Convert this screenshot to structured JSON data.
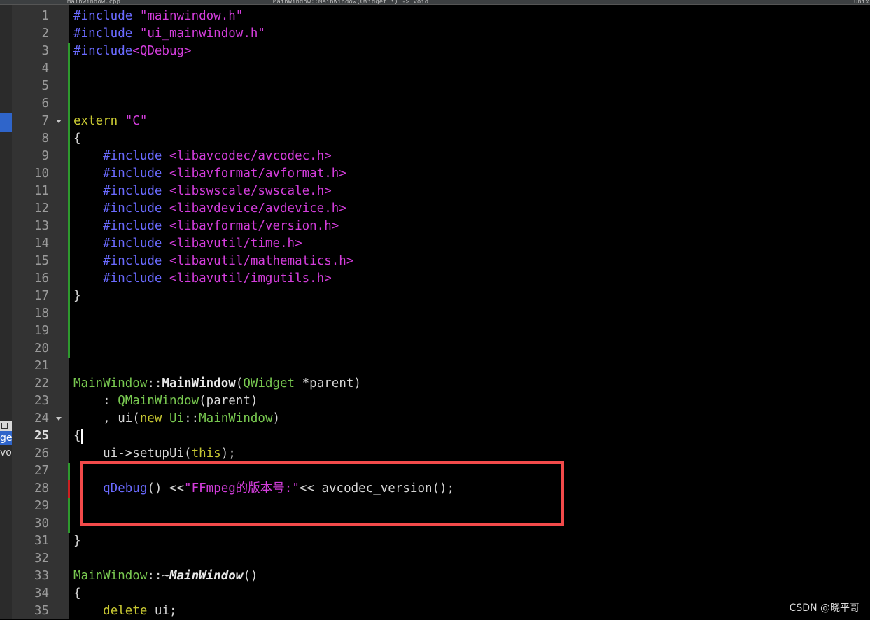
{
  "tabs": {
    "left": "mainwindow.cpp",
    "middle": "MainWindow::MainWindow(QWidget *) -> void",
    "right": "Unix"
  },
  "colors": {
    "keyword": "#c8c832",
    "preprocessor": "#6a6aff",
    "string": "#d33ddb",
    "type": "#78c850",
    "plain": "#d6d6d6",
    "highlight_box": "#f24a4a",
    "added_marker": "#2e9a2e",
    "modified_marker": "#cc2020"
  },
  "left_pane": {
    "items": [
      {
        "label": "get",
        "active": true
      },
      {
        "label": "voi",
        "active": false
      }
    ]
  },
  "editor": {
    "current_line": 25,
    "lines": [
      {
        "n": "1",
        "tokens": [
          {
            "t": "#include ",
            "c": "preprocessor"
          },
          {
            "t": "\"mainwindow.h\"",
            "c": "string"
          }
        ]
      },
      {
        "n": "2",
        "tokens": [
          {
            "t": "#include ",
            "c": "preprocessor"
          },
          {
            "t": "\"ui_mainwindow.h\"",
            "c": "string"
          }
        ]
      },
      {
        "n": "3",
        "mark": "added_marker",
        "tokens": [
          {
            "t": "#include",
            "c": "preprocessor"
          },
          {
            "t": "<QDebug>",
            "c": "string"
          }
        ]
      },
      {
        "n": "4",
        "mark": "added_marker",
        "tokens": []
      },
      {
        "n": "5",
        "mark": "added_marker",
        "tokens": []
      },
      {
        "n": "6",
        "mark": "added_marker",
        "tokens": []
      },
      {
        "n": "7",
        "mark": "added_marker",
        "fold": true,
        "tokens": [
          {
            "t": "extern ",
            "c": "keyword"
          },
          {
            "t": "\"C\"",
            "c": "string"
          }
        ]
      },
      {
        "n": "8",
        "mark": "added_marker",
        "tokens": [
          {
            "t": "{",
            "c": "plain"
          }
        ]
      },
      {
        "n": "9",
        "mark": "added_marker",
        "tokens": [
          {
            "t": "    #include ",
            "c": "preprocessor"
          },
          {
            "t": "<libavcodec/avcodec.h>",
            "c": "string"
          }
        ]
      },
      {
        "n": "10",
        "mark": "added_marker",
        "tokens": [
          {
            "t": "    #include ",
            "c": "preprocessor"
          },
          {
            "t": "<libavformat/avformat.h>",
            "c": "string"
          }
        ]
      },
      {
        "n": "11",
        "mark": "added_marker",
        "tokens": [
          {
            "t": "    #include ",
            "c": "preprocessor"
          },
          {
            "t": "<libswscale/swscale.h>",
            "c": "string"
          }
        ]
      },
      {
        "n": "12",
        "mark": "added_marker",
        "tokens": [
          {
            "t": "    #include ",
            "c": "preprocessor"
          },
          {
            "t": "<libavdevice/avdevice.h>",
            "c": "string"
          }
        ]
      },
      {
        "n": "13",
        "mark": "added_marker",
        "tokens": [
          {
            "t": "    #include ",
            "c": "preprocessor"
          },
          {
            "t": "<libavformat/version.h>",
            "c": "string"
          }
        ]
      },
      {
        "n": "14",
        "mark": "added_marker",
        "tokens": [
          {
            "t": "    #include ",
            "c": "preprocessor"
          },
          {
            "t": "<libavutil/time.h>",
            "c": "string"
          }
        ]
      },
      {
        "n": "15",
        "mark": "added_marker",
        "tokens": [
          {
            "t": "    #include ",
            "c": "preprocessor"
          },
          {
            "t": "<libavutil/mathematics.h>",
            "c": "string"
          }
        ]
      },
      {
        "n": "16",
        "mark": "added_marker",
        "tokens": [
          {
            "t": "    #include ",
            "c": "preprocessor"
          },
          {
            "t": "<libavutil/imgutils.h>",
            "c": "string"
          }
        ]
      },
      {
        "n": "17",
        "mark": "added_marker",
        "tokens": [
          {
            "t": "}",
            "c": "plain"
          }
        ]
      },
      {
        "n": "18",
        "mark": "added_marker",
        "tokens": []
      },
      {
        "n": "19",
        "mark": "added_marker",
        "tokens": []
      },
      {
        "n": "20",
        "mark": "added_marker",
        "tokens": []
      },
      {
        "n": "21",
        "tokens": []
      },
      {
        "n": "22",
        "tokens": [
          {
            "t": "MainWindow",
            "c": "type"
          },
          {
            "t": "::",
            "c": "plain"
          },
          {
            "t": "MainWindow",
            "c": "bold"
          },
          {
            "t": "(",
            "c": "plain"
          },
          {
            "t": "QWidget",
            "c": "type"
          },
          {
            "t": " *parent)",
            "c": "plain"
          }
        ]
      },
      {
        "n": "23",
        "tokens": [
          {
            "t": "    : ",
            "c": "plain"
          },
          {
            "t": "QMainWindow",
            "c": "type"
          },
          {
            "t": "(parent)",
            "c": "plain"
          }
        ]
      },
      {
        "n": "24",
        "fold": true,
        "tokens": [
          {
            "t": "    , ui(",
            "c": "plain"
          },
          {
            "t": "new ",
            "c": "keyword"
          },
          {
            "t": "Ui",
            "c": "type"
          },
          {
            "t": "::",
            "c": "plain"
          },
          {
            "t": "MainWindow",
            "c": "type"
          },
          {
            "t": ")",
            "c": "plain"
          }
        ]
      },
      {
        "n": "25",
        "tokens": [
          {
            "t": "{",
            "c": "plain"
          }
        ]
      },
      {
        "n": "26",
        "tokens": [
          {
            "t": "    ui->setupUi(",
            "c": "plain"
          },
          {
            "t": "this",
            "c": "keyword"
          },
          {
            "t": ");",
            "c": "plain"
          }
        ]
      },
      {
        "n": "27",
        "mark": "added_marker",
        "tokens": []
      },
      {
        "n": "28",
        "mark": "modified_marker",
        "tokens": [
          {
            "t": "    qDebug",
            "c": "preprocessor"
          },
          {
            "t": "() <<",
            "c": "plain"
          },
          {
            "t": "\"FFmpeg的版本号:\"",
            "c": "string"
          },
          {
            "t": "<< avcodec_version();",
            "c": "plain"
          }
        ]
      },
      {
        "n": "29",
        "mark": "added_marker",
        "tokens": []
      },
      {
        "n": "30",
        "mark": "added_marker",
        "tokens": []
      },
      {
        "n": "31",
        "tokens": [
          {
            "t": "}",
            "c": "plain"
          }
        ]
      },
      {
        "n": "32",
        "tokens": []
      },
      {
        "n": "33",
        "tokens": [
          {
            "t": "MainWindow",
            "c": "type"
          },
          {
            "t": "::~",
            "c": "plain"
          },
          {
            "t": "MainWindow",
            "c": "bolditalic"
          },
          {
            "t": "()",
            "c": "plain"
          }
        ]
      },
      {
        "n": "34",
        "tokens": [
          {
            "t": "{",
            "c": "plain"
          }
        ]
      },
      {
        "n": "35",
        "tokens": [
          {
            "t": "    ",
            "c": "plain"
          },
          {
            "t": "delete ",
            "c": "keyword"
          },
          {
            "t": "ui;",
            "c": "plain"
          }
        ]
      }
    ]
  },
  "watermark": "CSDN @晓平哥"
}
